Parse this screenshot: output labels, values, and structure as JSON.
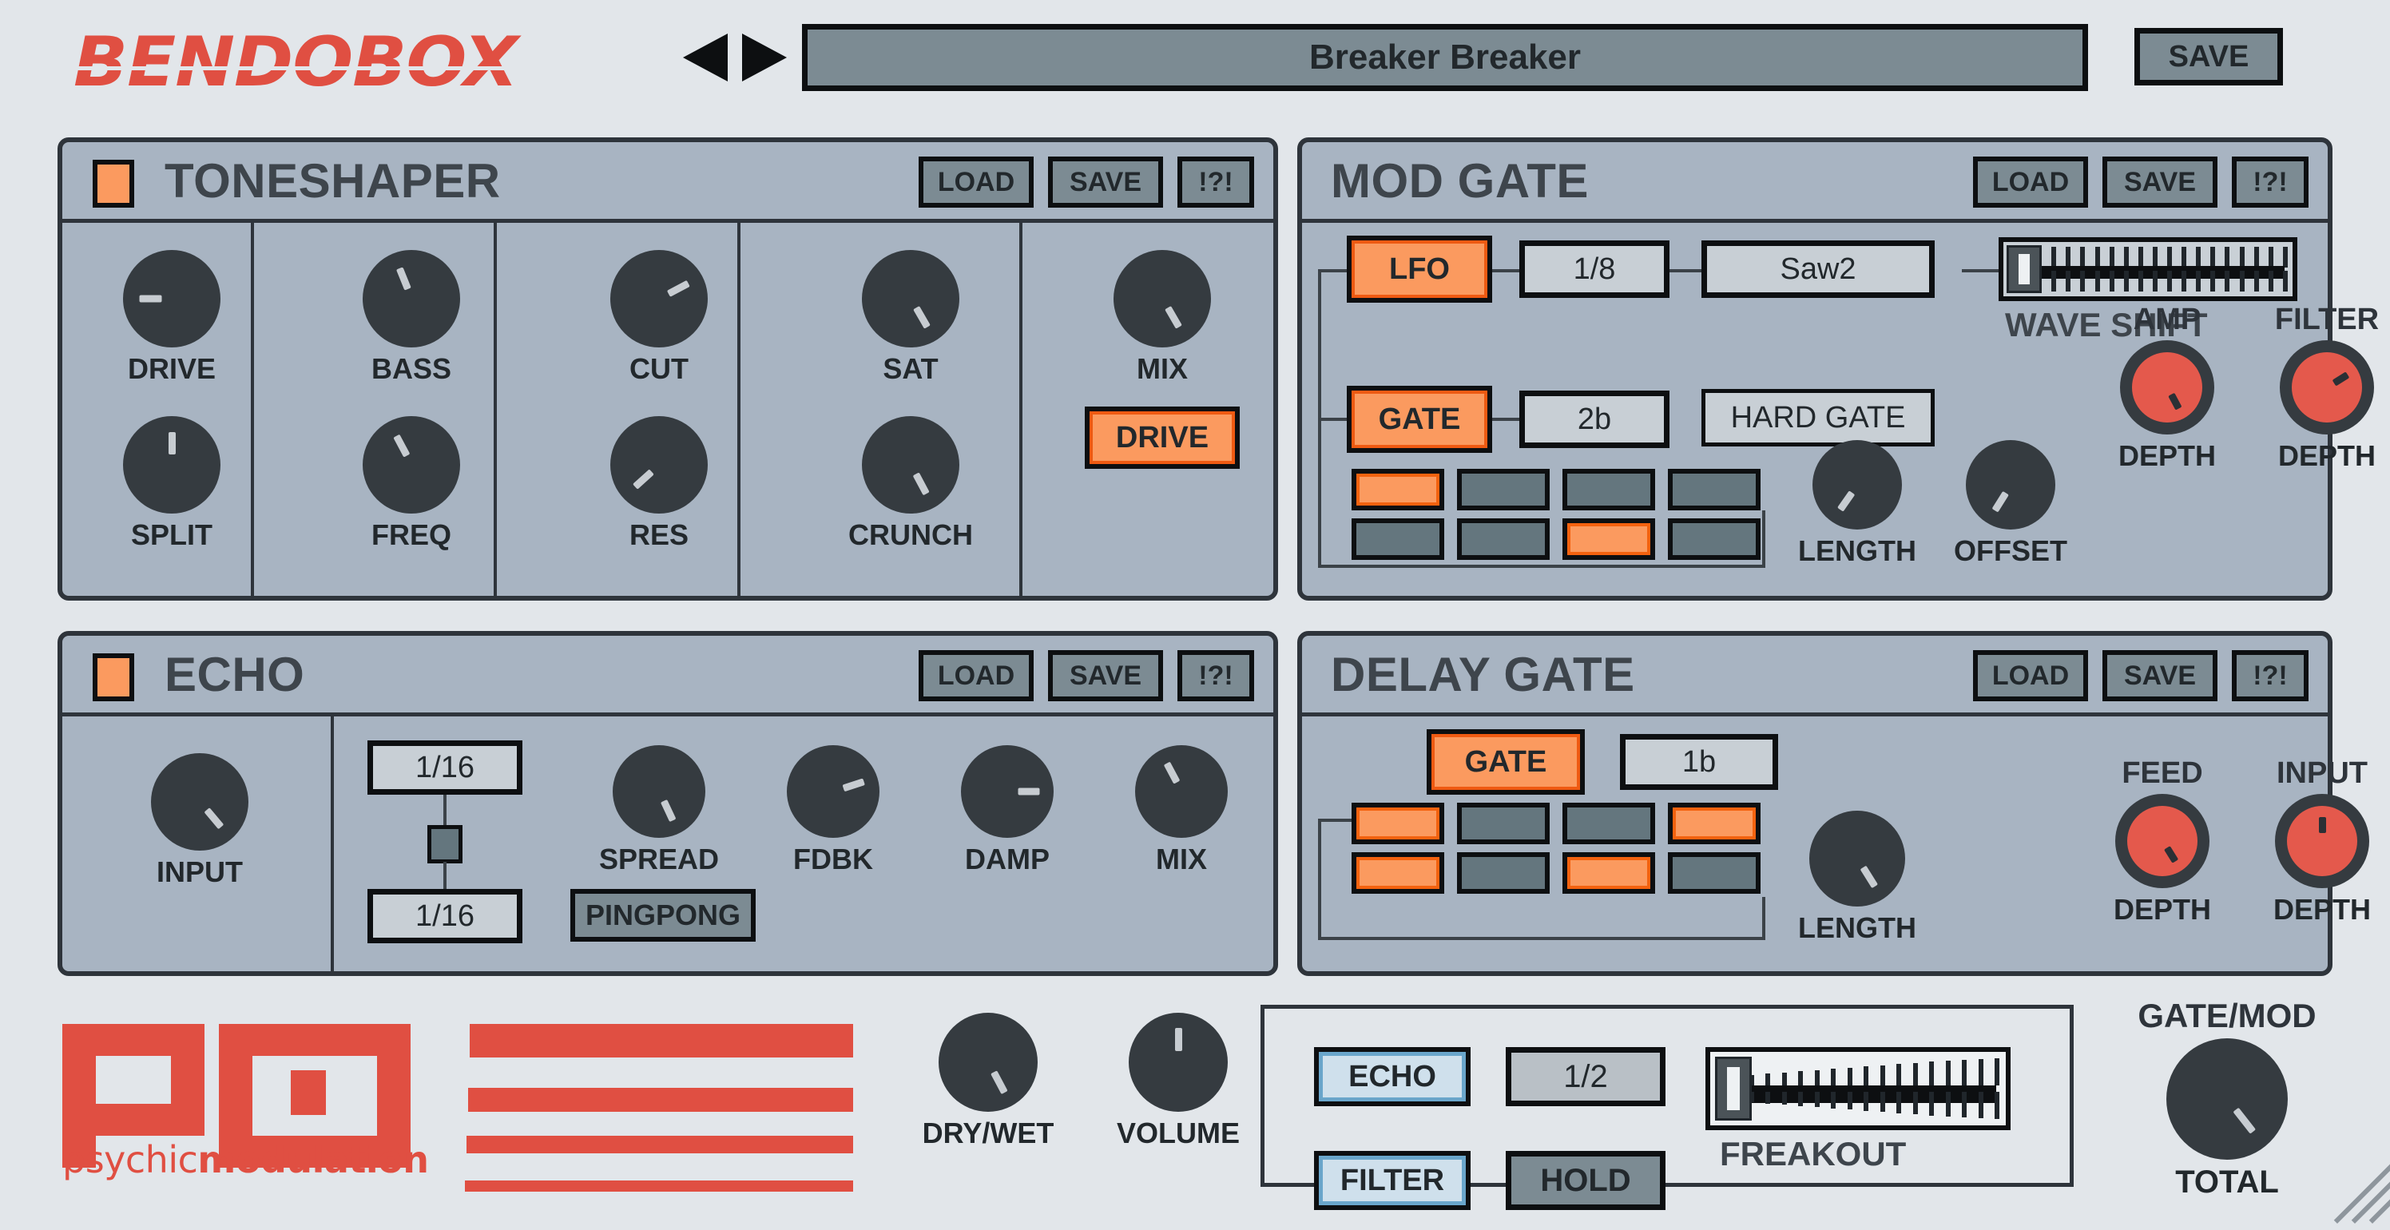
{
  "app": {
    "brand": "BENDOBOX",
    "vendor_name": "psychicmodulation",
    "vendor_name_part1": "psychic",
    "vendor_name_part2": "modulation",
    "accent_orange": "#fb9a5f",
    "accent_red": "#e04f42",
    "panel_bg": "#a8b4c2",
    "window_bg": "#e2e6ea"
  },
  "topbar": {
    "preset_name": "Breaker Breaker",
    "save_label": "SAVE",
    "prev_icon": "triangle-left-icon",
    "next_icon": "triangle-right-icon"
  },
  "toneshaper": {
    "title": "TONESHAPER",
    "enabled": true,
    "load_label": "LOAD",
    "save_label": "SAVE",
    "help_label": "!?!",
    "knobs": [
      {
        "label": "DRIVE",
        "angle": -90
      },
      {
        "label": "SPLIT",
        "angle": 0
      },
      {
        "label": "BASS",
        "angle": -22
      },
      {
        "label": "FREQ",
        "angle": -28
      },
      {
        "label": "CUT",
        "angle": 62
      },
      {
        "label": "RES",
        "angle": -132
      },
      {
        "label": "SAT",
        "angle": 150
      },
      {
        "label": "CRUNCH",
        "angle": 152
      },
      {
        "label": "MIX",
        "angle": 150
      }
    ],
    "drive_button": "DRIVE",
    "drive_active": true
  },
  "modgate": {
    "title": "MOD GATE",
    "enabled": false,
    "load_label": "LOAD",
    "save_label": "SAVE",
    "help_label": "!?!",
    "lfo_button": "LFO",
    "lfo_active": true,
    "lfo_rate": "1/8",
    "lfo_wave": "Saw2",
    "gate_button": "GATE",
    "gate_active": true,
    "gate_rate": "2b",
    "gate_mode": "HARD GATE",
    "waveshift_label": "WAVE SHIFT",
    "waveshift_value": 0,
    "steps_row1": [
      true,
      false,
      false,
      false
    ],
    "steps_row2": [
      false,
      false,
      true,
      false
    ],
    "knobs": [
      {
        "label": "LENGTH",
        "toplabel": "",
        "angle": -145,
        "style": "dark"
      },
      {
        "label": "OFFSET",
        "toplabel": "",
        "angle": -148,
        "style": "dark"
      },
      {
        "label": "DEPTH",
        "toplabel": "AMP",
        "angle": 152,
        "style": "red"
      },
      {
        "label": "DEPTH",
        "toplabel": "FILTER",
        "angle": 58,
        "style": "red"
      }
    ]
  },
  "echo": {
    "title": "ECHO",
    "enabled": true,
    "load_label": "LOAD",
    "save_label": "SAVE",
    "help_label": "!?!",
    "input_knob": {
      "label": "INPUT",
      "angle": 140
    },
    "time_left": "1/16",
    "time_right": "1/16",
    "link_icon": "link-square-icon",
    "pingpong_label": "PINGPONG",
    "pingpong_active": false,
    "knobs": [
      {
        "label": "SPREAD",
        "angle": 155
      },
      {
        "label": "FDBK",
        "angle": 72
      },
      {
        "label": "DAMP",
        "angle": 90
      },
      {
        "label": "MIX",
        "angle": -28
      }
    ]
  },
  "delaygate": {
    "title": "DELAY GATE",
    "enabled": false,
    "load_label": "LOAD",
    "save_label": "SAVE",
    "help_label": "!?!",
    "gate_button": "GATE",
    "gate_active": true,
    "gate_rate": "1b",
    "steps_row1": [
      true,
      false,
      false,
      true
    ],
    "steps_row2": [
      true,
      false,
      true,
      false
    ],
    "knobs": [
      {
        "label": "LENGTH",
        "toplabel": "",
        "angle": 148,
        "style": "dark"
      },
      {
        "label": "DEPTH",
        "toplabel": "FEED",
        "angle": 148,
        "style": "red"
      },
      {
        "label": "DEPTH",
        "toplabel": "INPUT",
        "angle": 0,
        "style": "red"
      }
    ]
  },
  "bottombar": {
    "drywet": {
      "label": "DRY/WET",
      "angle": 152
    },
    "volume": {
      "label": "VOLUME",
      "angle": 0
    },
    "total": {
      "toplabel": "GATE/MOD",
      "label": "TOTAL",
      "angle": 142
    },
    "freakout": {
      "echo_label": "ECHO",
      "echo_active": true,
      "filter_label": "FILTER",
      "filter_active": true,
      "rate_value": "1/2",
      "hold_label": "HOLD",
      "hold_active": false,
      "slider_label": "FREAKOUT",
      "slider_value": 0
    },
    "resize_icon": "resize-grip-icon"
  }
}
